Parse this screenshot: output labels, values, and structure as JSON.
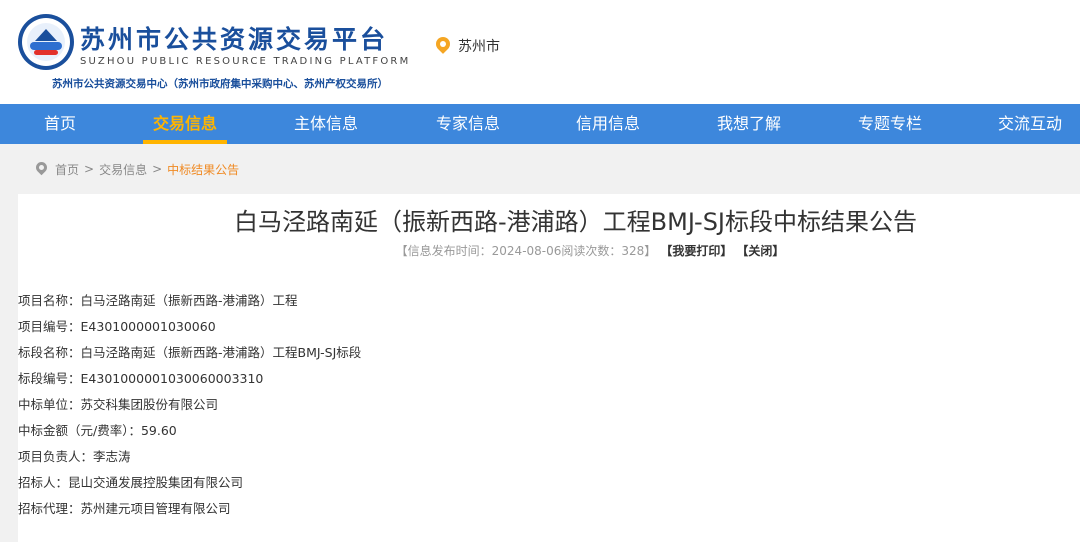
{
  "header": {
    "title": "苏州市公共资源交易平台",
    "title_en": "SUZHOU PUBLIC RESOURCE TRADING PLATFORM",
    "subtitle": "苏州市公共资源交易中心（苏州市政府集中采购中心、苏州产权交易所）",
    "location": "苏州市",
    "logo_icon": "emblem-logo-icon",
    "location_icon": "map-pin-icon",
    "brand_color": "#1a4f9c",
    "accent_color": "#f5a623"
  },
  "nav": {
    "color": "#3d87dc",
    "active_color": "#ffb400",
    "items": [
      {
        "label": "首页"
      },
      {
        "label": "交易信息",
        "active": true
      },
      {
        "label": "主体信息"
      },
      {
        "label": "专家信息"
      },
      {
        "label": "信用信息"
      },
      {
        "label": "我想了解"
      },
      {
        "label": "专题专栏"
      },
      {
        "label": "交流互动"
      }
    ]
  },
  "breadcrumb": {
    "icon": "location-icon",
    "items": [
      "首页",
      "交易信息",
      "中标结果公告"
    ],
    "separator": ">"
  },
  "article": {
    "title": "白马泾路南延（振新西路-港浦路）工程BMJ-SJ标段中标结果公告",
    "meta": "【信息发布时间：2024-08-06阅读次数：328】",
    "print_label": "【我要打印】",
    "close_label": "【关闭】",
    "fields": [
      {
        "label": "项目名称：",
        "value": "白马泾路南延（振新西路-港浦路）工程"
      },
      {
        "label": "项目编号：",
        "value": "E4301000001030060"
      },
      {
        "label": "标段名称：",
        "value": "白马泾路南延（振新西路-港浦路）工程BMJ-SJ标段"
      },
      {
        "label": "标段编号：",
        "value": "E4301000001030060003310"
      },
      {
        "label": "中标单位：",
        "value": "苏交科集团股份有限公司"
      },
      {
        "label": "中标金额（元/费率）：",
        "value": "59.60"
      },
      {
        "label": "项目负责人：",
        "value": "李志涛"
      },
      {
        "label": "招标人：",
        "value": "昆山交通发展控股集团有限公司"
      },
      {
        "label": "招标代理：",
        "value": "苏州建元项目管理有限公司"
      }
    ]
  }
}
